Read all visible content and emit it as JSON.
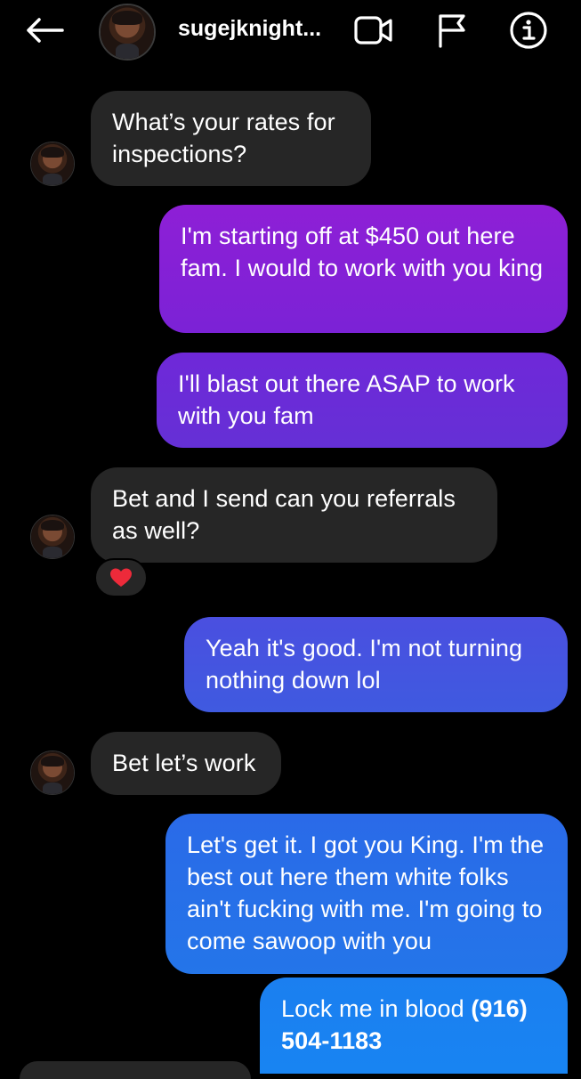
{
  "header": {
    "username": "sugejknight...",
    "back_icon": "arrow-left-icon",
    "video_icon": "video-camera-icon",
    "flag_icon": "flag-icon",
    "info_icon": "info-icon"
  },
  "messages": [
    {
      "sender": "them",
      "text": "What’s your rates for inspections?"
    },
    {
      "sender": "me",
      "text": "I'm starting off at $450 out here fam. I would to work with you king"
    },
    {
      "sender": "me",
      "text": "I'll blast out there ASAP to work with you fam"
    },
    {
      "sender": "them",
      "text": "Bet and I send can you referrals as well?",
      "reaction": "❤️"
    },
    {
      "sender": "me",
      "text": "Yeah it's good. I'm not turning nothing down lol"
    },
    {
      "sender": "them",
      "text": "Bet let’s work"
    },
    {
      "sender": "me",
      "text": "Let's get it. I got you King. I'm the best out here them white folks ain't fucking with me. I'm going to come sawoop with you"
    },
    {
      "sender": "me",
      "text_prefix": "Lock me in blood ",
      "text_bold": "(916) 504-1183"
    }
  ],
  "colors": {
    "background": "#000000",
    "incoming_bubble": "#262626",
    "outgoing_purple": "#8e1fd6",
    "outgoing_violet": "#6f28d8",
    "outgoing_indigo": "#4a4fe0",
    "outgoing_blue": "#2a6ae8",
    "outgoing_bright_blue": "#1b7ff0",
    "heart": "#ed2a3a"
  }
}
